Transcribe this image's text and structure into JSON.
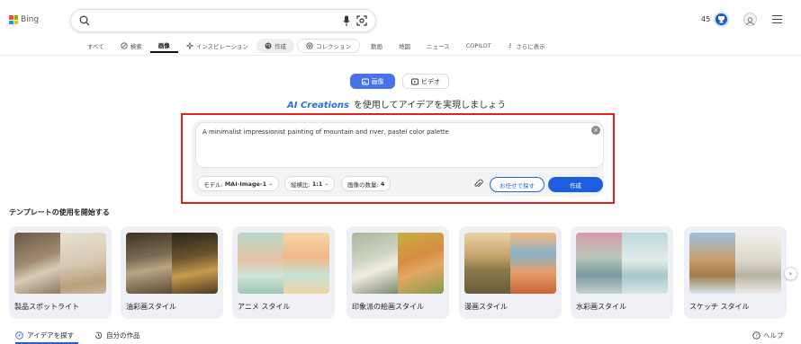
{
  "header": {
    "logo_text": "Bing",
    "search_value": "",
    "rewards_count": "45"
  },
  "nav": [
    {
      "label": "すべて",
      "icon": ""
    },
    {
      "label": "検索",
      "icon": "copilot-search-icon"
    },
    {
      "label": "画像",
      "icon": "",
      "active": true
    },
    {
      "label": "インスピレーション",
      "icon": "sparkle-icon"
    },
    {
      "label": "作成",
      "icon": "palette-icon",
      "pill": true
    },
    {
      "label": "コレクション",
      "icon": "collection-icon"
    },
    {
      "label": "動画",
      "icon": ""
    },
    {
      "label": "地図",
      "icon": ""
    },
    {
      "label": "ニュース",
      "icon": ""
    },
    {
      "label": "COPILOT",
      "icon": ""
    },
    {
      "label": "さらに表示",
      "icon": "more-icon"
    }
  ],
  "mode": {
    "image_label": "画像",
    "video_label": "ビデオ"
  },
  "tagline": {
    "brand": "AI Creations",
    "text": "を使用してアイデアを実現しましょう"
  },
  "prompt": {
    "value": "A minimalist impressionist painting of mountain and river, pastel color palette",
    "model_label": "モデル:",
    "model_value": "MAI-Image-1",
    "ratio_label": "縦横比:",
    "ratio_value": "1:1",
    "count_label": "画像の数量:",
    "count_value": "4",
    "surprise_label": "お任せで探す",
    "create_label": "作成"
  },
  "templates_heading": "テンプレートの使用を開始する",
  "templates": [
    {
      "label": "製品スポットライト"
    },
    {
      "label": "油彩画スタイル"
    },
    {
      "label": "アニメ スタイル"
    },
    {
      "label": "印象派の絵画スタイル"
    },
    {
      "label": "漫画スタイル"
    },
    {
      "label": "水彩画スタイル"
    },
    {
      "label": "スケッチ スタイル"
    }
  ],
  "bottom": {
    "explore_label": "アイデアを探す",
    "mine_label": "自分の作品",
    "help_label": "ヘルプ"
  },
  "colors": {
    "accent": "#1d5fe0",
    "highlight_border": "#e01f1f"
  }
}
